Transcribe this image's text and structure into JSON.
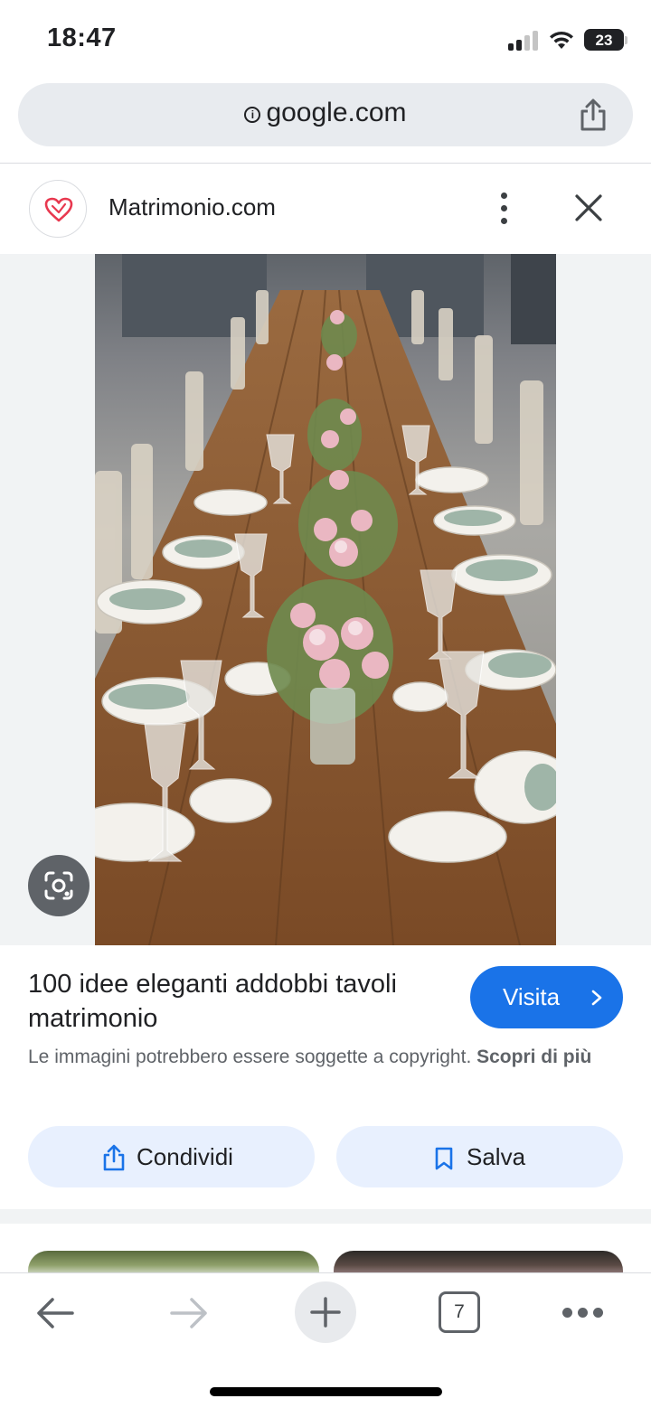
{
  "status_bar": {
    "time": "18:47",
    "battery_level": "23"
  },
  "url_bar": {
    "domain": "google.com",
    "info_icon": "info-icon",
    "share_icon": "share-icon"
  },
  "source": {
    "name": "Matrimonio.com",
    "favicon_icon": "heart-icon",
    "favicon_color": "#e8384f",
    "more_icon": "more-vert-icon",
    "close_icon": "close-icon"
  },
  "image": {
    "lens_icon": "lens-icon"
  },
  "result": {
    "title": "100 idee eleganti addobbi tavoli matrimonio",
    "visit_label": "Visita",
    "copyright_text": "Le immagini potrebbero essere soggette a copyright.",
    "learn_more": "Scopri di più",
    "share_label": "Condividi",
    "save_label": "Salva",
    "accent_color": "#1a73e8"
  },
  "toolbar": {
    "tab_count": "7",
    "back_icon": "arrow-left-icon",
    "forward_icon": "arrow-right-icon",
    "new_tab_icon": "plus-icon",
    "menu_icon": "more-horiz-icon"
  }
}
